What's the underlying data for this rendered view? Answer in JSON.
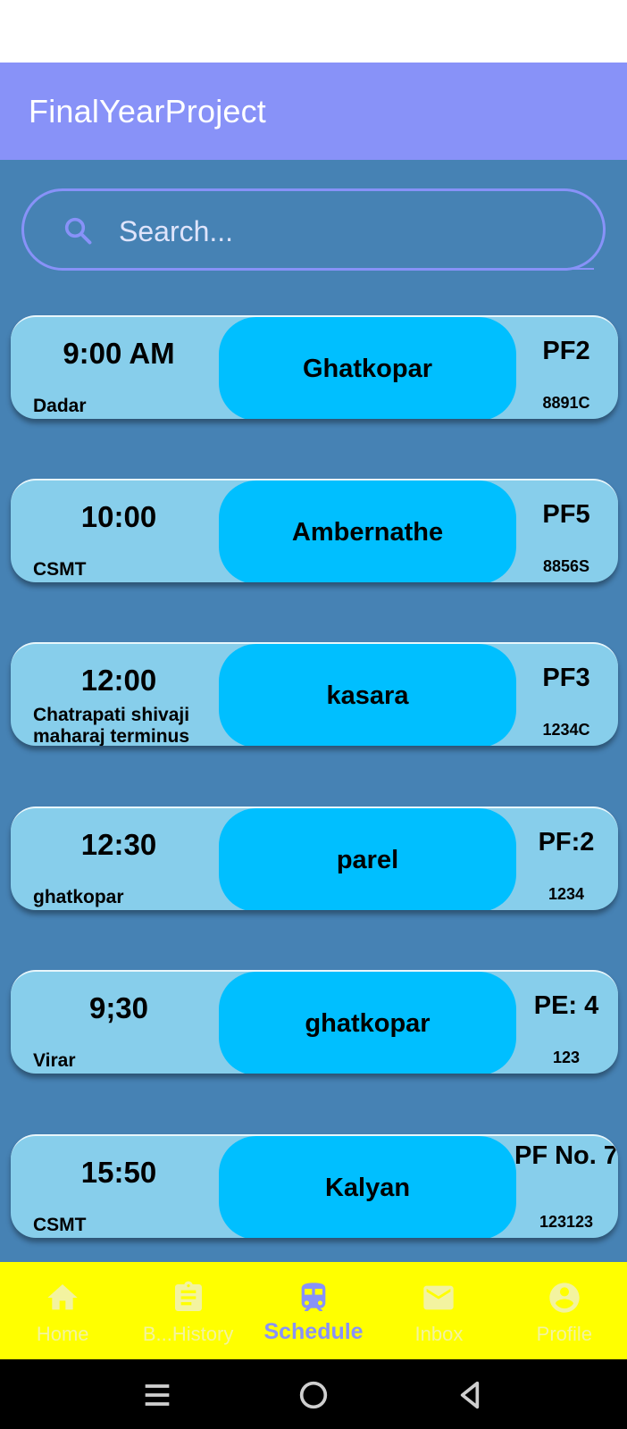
{
  "app": {
    "title": "FinalYearProject"
  },
  "search": {
    "placeholder": "Search...",
    "icon": "search-icon"
  },
  "schedule": [
    {
      "time": "9:00 AM",
      "origin": "Dadar",
      "destination": "Ghatkopar",
      "platform": "PF2",
      "train": "8891C"
    },
    {
      "time": "10:00",
      "origin": "CSMT",
      "destination": "Ambernathe",
      "platform": "PF5",
      "train": "8856S"
    },
    {
      "time": "12:00",
      "origin": "Chatrapati shivaji maharaj terminus",
      "destination": "kasara",
      "platform": "PF3",
      "train": "1234C"
    },
    {
      "time": "12:30",
      "origin": "ghatkopar",
      "destination": "parel",
      "platform": "PF:2",
      "train": "1234"
    },
    {
      "time": "9;30",
      "origin": "Virar",
      "destination": "ghatkopar",
      "platform": "PE: 4",
      "train": "123"
    },
    {
      "time": "15:50",
      "origin": "CSMT",
      "destination": "Kalyan",
      "platform": "PF No. 7",
      "train": "123123"
    }
  ],
  "bottom_nav": [
    {
      "label": "Home",
      "icon": "home-icon",
      "active": false
    },
    {
      "label": "B...History",
      "icon": "clipboard-icon",
      "active": false
    },
    {
      "label": "Schedule",
      "icon": "train-icon",
      "active": true
    },
    {
      "label": "Inbox",
      "icon": "mail-icon",
      "active": false
    },
    {
      "label": "Profile",
      "icon": "account-icon",
      "active": false
    }
  ],
  "colors": {
    "app_bar": "#8892f8",
    "background": "#4682b4",
    "card": "#87ceeb",
    "destination_pill": "#00bfff",
    "bottom_nav": "#ffff00",
    "active_nav": "#8892f8"
  }
}
